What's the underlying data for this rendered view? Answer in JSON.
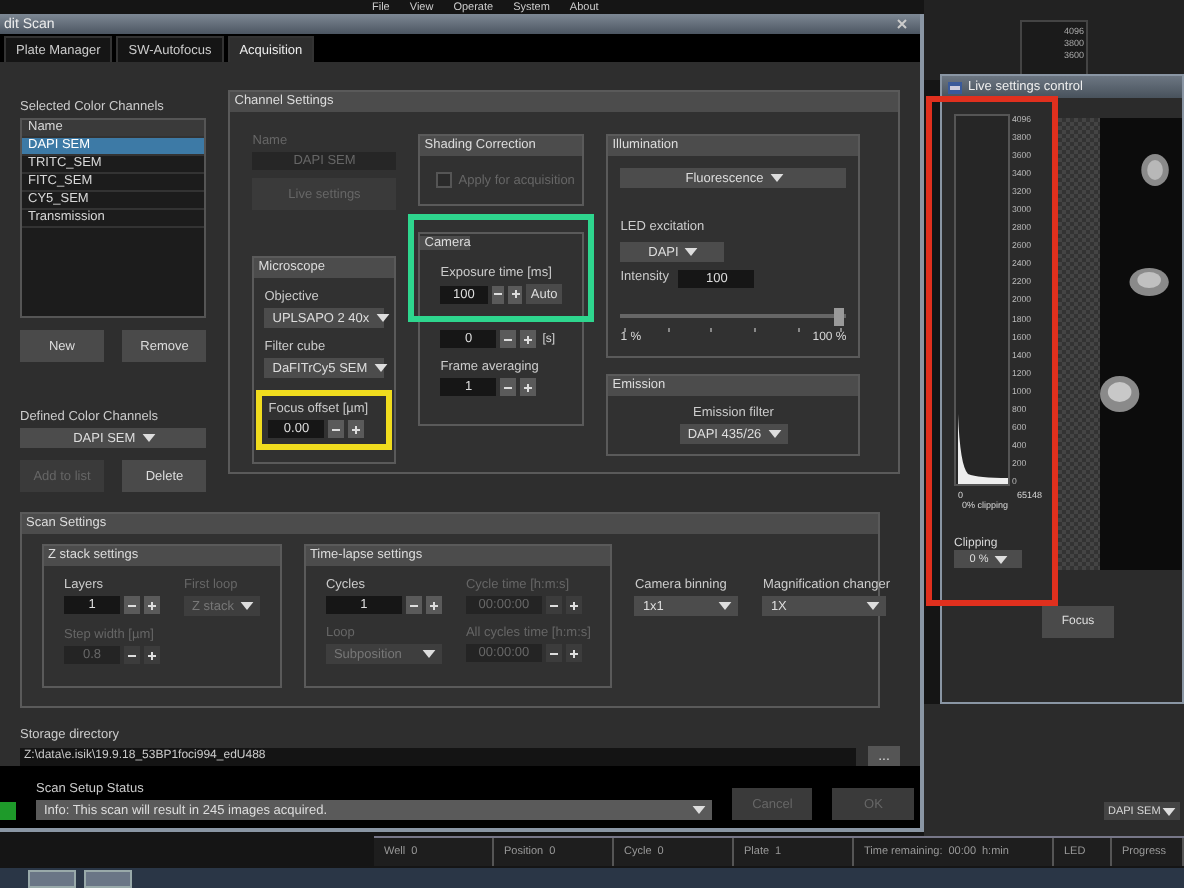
{
  "background_app": {
    "menu": [
      "File",
      "View",
      "Operate",
      "System",
      "About"
    ],
    "histogram_ticks": [
      "4096",
      "3800",
      "3600"
    ],
    "channel_dropdown": "DAPI SEM",
    "status_bar": [
      {
        "label": "Well",
        "value": "0"
      },
      {
        "label": "Position",
        "value": "0"
      },
      {
        "label": "Cycle",
        "value": "0"
      },
      {
        "label": "Plate",
        "value": "1"
      },
      {
        "label": "Time remaining:",
        "value": "00:00",
        "unit": "h:min"
      },
      {
        "label": "LED"
      },
      {
        "label": "Progress"
      }
    ]
  },
  "dialog": {
    "title": "dit Scan",
    "tabs": [
      {
        "label": "Plate Manager",
        "selected": false
      },
      {
        "label": "SW-Autofocus",
        "selected": false
      },
      {
        "label": "Acquisition",
        "selected": true
      }
    ],
    "selected_channels": {
      "label": "Selected Color Channels",
      "header": "Name",
      "rows": [
        {
          "name": "DAPI SEM",
          "selected": true
        },
        {
          "name": "TRITC_SEM",
          "selected": false
        },
        {
          "name": "FITC_SEM",
          "selected": false
        },
        {
          "name": "CY5_SEM",
          "selected": false
        },
        {
          "name": "Transmission",
          "selected": false
        }
      ],
      "buttons": [
        {
          "label": "New",
          "disabled": false
        },
        {
          "label": "Remove",
          "disabled": false
        }
      ]
    },
    "defined_channels": {
      "label": "Defined Color Channels",
      "value": "DAPI SEM",
      "buttons": [
        {
          "label": "Add to list",
          "disabled": true
        },
        {
          "label": "Delete",
          "disabled": false
        }
      ]
    },
    "channel_settings": {
      "title": "Channel Settings",
      "name_label": "Name",
      "name_value": "DAPI SEM",
      "live_button": {
        "label": "Live settings",
        "disabled": true
      },
      "shading": {
        "title": "Shading Correction",
        "label": "Apply for acquisition",
        "checked": false,
        "disabled": true
      },
      "illumination": {
        "title": "Illumination",
        "mode": "Fluorescence",
        "led_label": "LED excitation",
        "led": "DAPI",
        "intensity_label": "Intensity",
        "intensity": "100",
        "level": 0.97,
        "min_label": "1 %",
        "max_label": "100 %"
      },
      "microscope": {
        "title": "Microscope",
        "fields": [
          {
            "kind": "dropdown",
            "label": "Objective",
            "value": "UPLSAPO 2 40x",
            "disabled": false
          },
          {
            "kind": "dropdown",
            "label": "Filter cube",
            "value": "DaFITrCy5 SEM",
            "disabled": false
          },
          {
            "kind": "spinner",
            "label": "Focus offset [µm]",
            "value": "0.00",
            "disabled": false,
            "highlight": {
              "color": "#f0dc1e"
            }
          }
        ]
      },
      "camera": {
        "title": "Camera",
        "highlight": {
          "color": "#2ed68e"
        },
        "fields": [
          {
            "kind": "spinner",
            "label": "Exposure time [ms]",
            "value": "100",
            "auto": "Auto",
            "disabled": false
          },
          {
            "kind": "spinner",
            "value": "0",
            "unit": "[s]",
            "disabled": false
          },
          {
            "kind": "spinner",
            "label": "Frame averaging",
            "value": "1",
            "disabled": false
          }
        ]
      },
      "emission": {
        "title": "Emission",
        "fields": [
          {
            "kind": "dropdown",
            "label": "Emission filter",
            "value": "DAPI 435/26",
            "disabled": false
          }
        ]
      }
    },
    "scan_settings": {
      "title": "Scan Settings",
      "z_stack": {
        "title": "Z stack settings",
        "fields": [
          {
            "kind": "spinner",
            "label": "Layers",
            "value": "1",
            "disabled": false
          },
          {
            "kind": "dropdown",
            "label": "First loop",
            "value": "Z stack",
            "disabled": true
          },
          {
            "kind": "spinner",
            "label": "Step width [µm]",
            "value": "0.8",
            "disabled": true
          }
        ]
      },
      "time_lapse": {
        "title": "Time-lapse settings",
        "fields": [
          {
            "kind": "spinner",
            "label": "Cycles",
            "value": "1",
            "disabled": false
          },
          {
            "kind": "spinner",
            "label": "Cycle time [h:m:s]",
            "value": "00:00:00",
            "disabled": true
          },
          {
            "kind": "dropdown",
            "label": "Loop",
            "value": "Subposition",
            "disabled": true
          },
          {
            "kind": "spinner",
            "label": "All cycles time [h:m:s]",
            "value": "00:00:00",
            "disabled": true
          }
        ]
      },
      "extra": [
        {
          "kind": "dropdown",
          "label": "Camera binning",
          "value": "1x1",
          "disabled": false
        },
        {
          "kind": "dropdown",
          "label": "Magnification changer",
          "value": "1X",
          "disabled": false
        }
      ]
    },
    "storage": {
      "label": "Storage directory",
      "path": "Z:\\data\\e.isik\\19.9.18_53BP1foci994_edU488",
      "browse": "..."
    },
    "status": {
      "label": "Scan Setup Status",
      "color": "#1e9a2a",
      "message": "Info: This scan will result in 245 images acquired.",
      "buttons": [
        {
          "label": "Cancel",
          "disabled": true
        },
        {
          "label": "OK",
          "disabled": true
        }
      ]
    }
  },
  "live_window": {
    "title": "Live settings control",
    "highlight": {
      "color": "#e0301e"
    },
    "ticks": [
      "4096",
      "3800",
      "3600",
      "3400",
      "3200",
      "3000",
      "2800",
      "2600",
      "2400",
      "2200",
      "2000",
      "1800",
      "1600",
      "1400",
      "1200",
      "1000",
      "800",
      "600",
      "400",
      "200",
      "0"
    ],
    "x_min": "0",
    "x_max": "65148",
    "clipping_note": "0% clipping",
    "clipping_label": "Clipping",
    "clipping": "0 %",
    "focus": "Focus"
  }
}
